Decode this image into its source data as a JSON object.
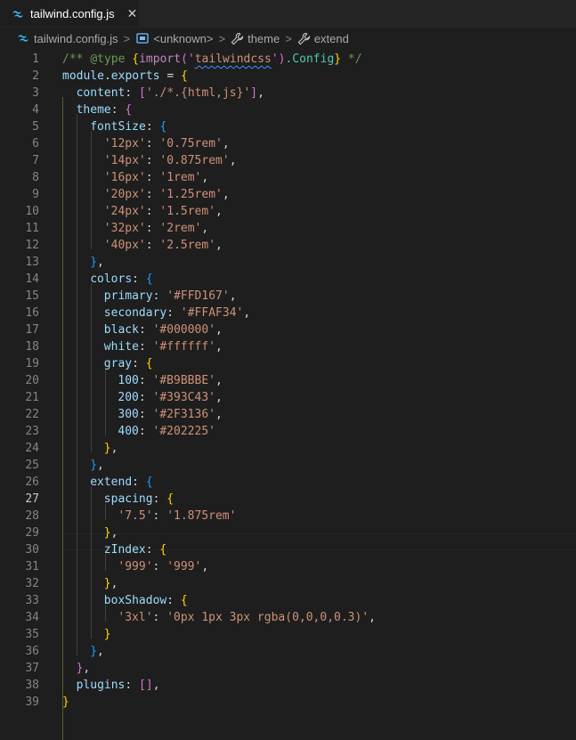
{
  "tab": {
    "title": "tailwind.config.js",
    "close_glyph": "✕",
    "icon": "tailwind-icon"
  },
  "breadcrumb": {
    "file": "tailwind.config.js",
    "sep": ">",
    "unknown": "<unknown>",
    "theme": "theme",
    "extend": "extend"
  },
  "active_line": 27,
  "line_numbers": [
    "1",
    "2",
    "3",
    "4",
    "5",
    "6",
    "7",
    "8",
    "9",
    "10",
    "11",
    "12",
    "13",
    "14",
    "15",
    "16",
    "17",
    "18",
    "19",
    "20",
    "21",
    "22",
    "23",
    "24",
    "25",
    "26",
    "27",
    "28",
    "29",
    "30",
    "31",
    "32",
    "33",
    "34",
    "35",
    "36",
    "37",
    "38",
    "39"
  ],
  "code": {
    "l1": [
      "/** ",
      "@type",
      " {",
      "import",
      "('",
      "tailwindcss",
      "')",
      ".Config",
      "}",
      " */"
    ],
    "l2": [
      "module",
      ".",
      "exports",
      " = ",
      "{"
    ],
    "l3": [
      "content",
      ": ",
      "[",
      "'./*.{html,js}'",
      "]",
      ","
    ],
    "l4": [
      "theme",
      ": ",
      "{"
    ],
    "l5": [
      "fontSize",
      ": ",
      "{"
    ],
    "fontSize": [
      [
        "'12px'",
        "'0.75rem'"
      ],
      [
        "'14px'",
        "'0.875rem'"
      ],
      [
        "'16px'",
        "'1rem'"
      ],
      [
        "'20px'",
        "'1.25rem'"
      ],
      [
        "'24px'",
        "'1.5rem'"
      ],
      [
        "'32px'",
        "'2rem'"
      ],
      [
        "'40px'",
        "'2.5rem'"
      ]
    ],
    "close_brace_comma": "},",
    "close_brace": "}",
    "l14": [
      "colors",
      ": ",
      "{"
    ],
    "colors": [
      [
        "primary",
        "'#FFD167'"
      ],
      [
        "secondary",
        "'#FFAF34'"
      ],
      [
        "black",
        "'#000000'"
      ],
      [
        "white",
        "'#ffffff'"
      ]
    ],
    "l19": [
      "gray",
      ": ",
      "{"
    ],
    "gray": [
      [
        "100",
        "'#B9BBBE'"
      ],
      [
        "200",
        "'#393C43'"
      ],
      [
        "300",
        "'#2F3136'"
      ],
      [
        "400",
        "'#202225'"
      ]
    ],
    "l26": [
      "extend",
      ": ",
      "{"
    ],
    "l27": [
      "spacing",
      ": ",
      "{"
    ],
    "l28": [
      "'7.5'",
      "'1.875rem'"
    ],
    "l30": [
      "zIndex",
      ": ",
      "{"
    ],
    "l31": [
      "'999'",
      "'999'"
    ],
    "l33": [
      "boxShadow",
      ": ",
      "{"
    ],
    "l34": [
      "'3xl'",
      "'0px 1px 3px rgba(0,0,0,0.3)'"
    ],
    "l38": [
      "plugins",
      ": ",
      "[]",
      ","
    ],
    "colon": ": ",
    "comma": ","
  }
}
